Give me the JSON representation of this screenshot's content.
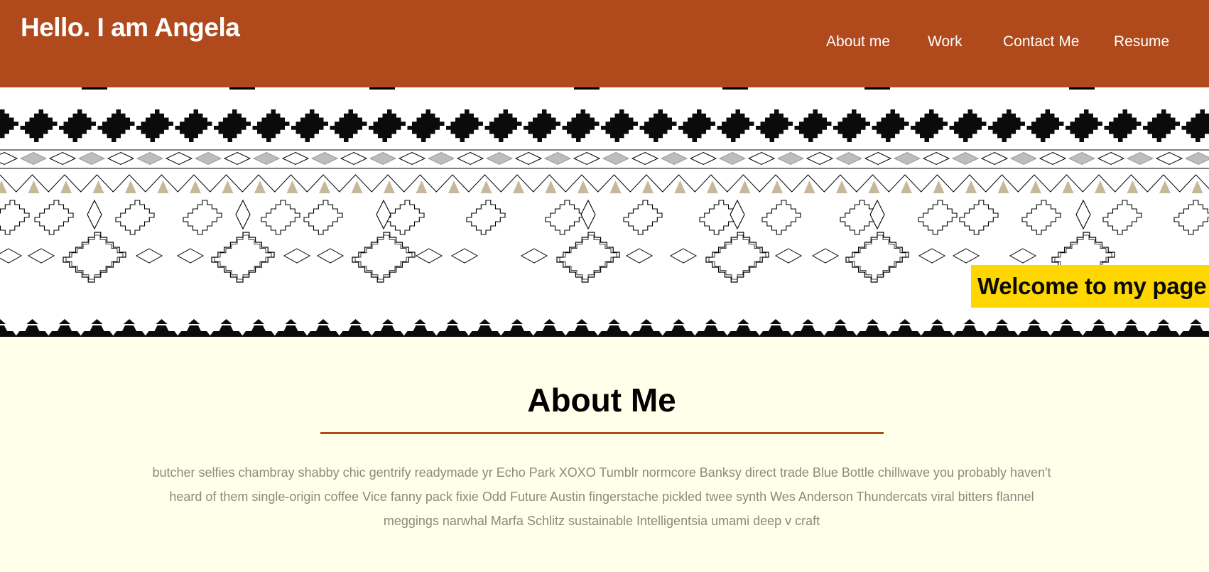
{
  "header": {
    "title": "Hello. I am Angela",
    "nav": [
      {
        "label": "About me"
      },
      {
        "label": "Work"
      },
      {
        "label": "Contact Me"
      },
      {
        "label": "Resume"
      }
    ]
  },
  "banner": {
    "welcome_text": "Welcome to my page !"
  },
  "about": {
    "heading": "About Me",
    "body": "butcher selfies chambray shabby chic gentrify readymade yr Echo Park XOXO Tumblr normcore Banksy direct trade Blue Bottle chillwave you probably haven't heard of them single-origin coffee Vice fanny pack fixie Odd Future Austin fingerstache pickled twee synth Wes Anderson Thundercats viral bitters flannel meggings narwhal Marfa Schlitz sustainable Intelligentsia umami deep v craft"
  },
  "colors": {
    "header_bg": "#B0491C",
    "page_bg": "#FFFFEA",
    "badge_bg": "#FFD700",
    "divider": "#B0491C",
    "body_text": "#8A8A7E"
  },
  "icons": [
    "tribal-pattern-banner"
  ]
}
